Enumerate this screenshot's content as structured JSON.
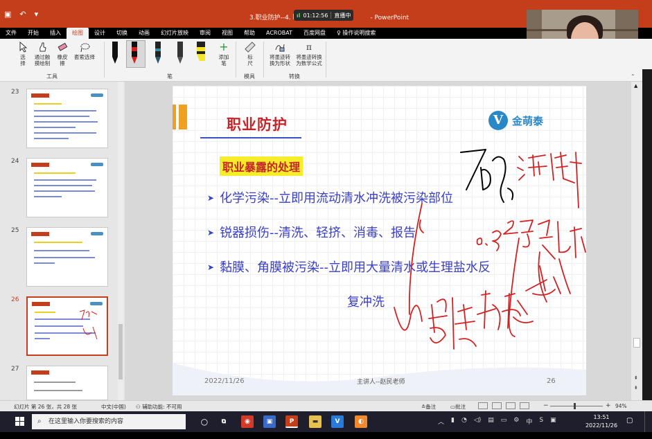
{
  "window": {
    "title": "3.职业防护--4. 职",
    "app_name": "- PowerPoint",
    "recording_time": "01:12:56",
    "recording_label": "直播中"
  },
  "ribbon_tabs": [
    "文件",
    "开始",
    "插入",
    "绘图",
    "设计",
    "切换",
    "动画",
    "幻灯片放映",
    "审阅",
    "视图",
    "帮助",
    "ACROBAT",
    "百度网盘",
    "操作说明搜索"
  ],
  "ribbon": {
    "tools_group": "工具",
    "select": "选\n择",
    "draw_touch": "通过触\n摸绘制",
    "eraser": "橡皮\n擦",
    "lasso": "套索选择",
    "pens_group": "笔",
    "add_pen": "添加\n笔",
    "ruler": "标\n尺",
    "stencils_group": "模具",
    "ink_to_shape": "将墨迹转\n换为形状",
    "ink_to_math": "将墨迹转换\n为数学公式",
    "convert_group": "转换"
  },
  "thumbnails": [
    {
      "num": "23"
    },
    {
      "num": "24"
    },
    {
      "num": "25"
    },
    {
      "num": "26"
    },
    {
      "num": "27"
    }
  ],
  "slide": {
    "title": "职业防护",
    "logo_letter": "V",
    "logo_name": "金萌泰",
    "subhead": "职业暴露的处理",
    "bullets": [
      "化学污染--立即用流动清水冲洗被污染部位",
      "锐器损伤--清洗、轻挤、消毒、报告",
      "黏膜、角膜被污染--立即用大量清水或生理盐水反"
    ],
    "bullet3_cont": "复冲洗",
    "date": "2022/11/26",
    "presenter": "主讲人--赵民老师",
    "page_num": "26"
  },
  "statusbar": {
    "slide_info": "幻灯片 第 26 张，共 28 张",
    "language": "中文(中国)",
    "accessibility": "辅助功能: 不可用",
    "notes": "备注",
    "comments": "批注",
    "zoom": "94%"
  },
  "taskbar": {
    "search_placeholder": "在这里输入你要搜索的内容",
    "time": "13:51",
    "date": "2022/11/26",
    "ime": "中"
  }
}
